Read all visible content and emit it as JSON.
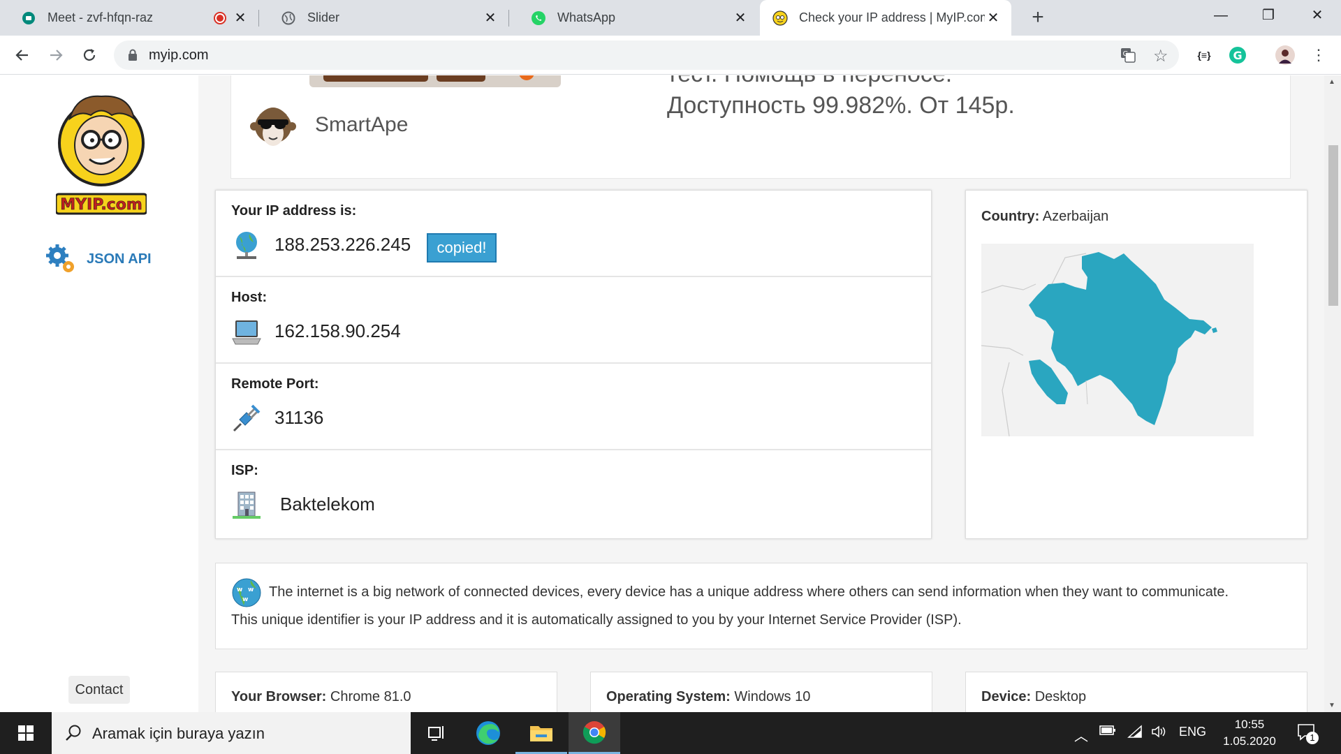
{
  "tabs": [
    {
      "title": "Meet - zvf-hfqn-raz"
    },
    {
      "title": "Slider"
    },
    {
      "title": "WhatsApp"
    },
    {
      "title": "Check your IP address | MyIP.com"
    }
  ],
  "address_bar": {
    "url": "myip.com"
  },
  "sidebar": {
    "logo_text": "MYIP.com",
    "json_api_label": "JSON API",
    "contact_label": "Contact"
  },
  "ad": {
    "brand": "SmartApe",
    "line1": "тест. Помощь в переносе.",
    "line2": "Доступность 99.982%. От 145р."
  },
  "ip_info": {
    "ip_label": "Your IP address is:",
    "ip_value": "188.253.226.245",
    "copied_badge": "copied!",
    "host_label": "Host:",
    "host_value": "162.158.90.254",
    "port_label": "Remote Port:",
    "port_value": "31136",
    "isp_label": "ISP:",
    "isp_value": "Baktelekom"
  },
  "country": {
    "label": "Country:",
    "value": "Azerbaijan",
    "map_color": "#2aa6c0"
  },
  "info_text": {
    "line1": "The internet is a big network of connected devices, every device has a unique address where others can send information when they want to communicate.",
    "line2": "This unique identifier is your IP address and it is automatically assigned to you by your Internet Service Provider (ISP)."
  },
  "details": {
    "browser_label": "Your Browser:",
    "browser_value": "Chrome 81.0",
    "os_label": "Operating System:",
    "os_value": "Windows 10",
    "device_label": "Device:",
    "device_value": "Desktop"
  },
  "taskbar": {
    "search_placeholder": "Aramak için buraya yazın",
    "language": "ENG",
    "time": "10:55",
    "date": "1.05.2020",
    "notification_count": "1"
  }
}
